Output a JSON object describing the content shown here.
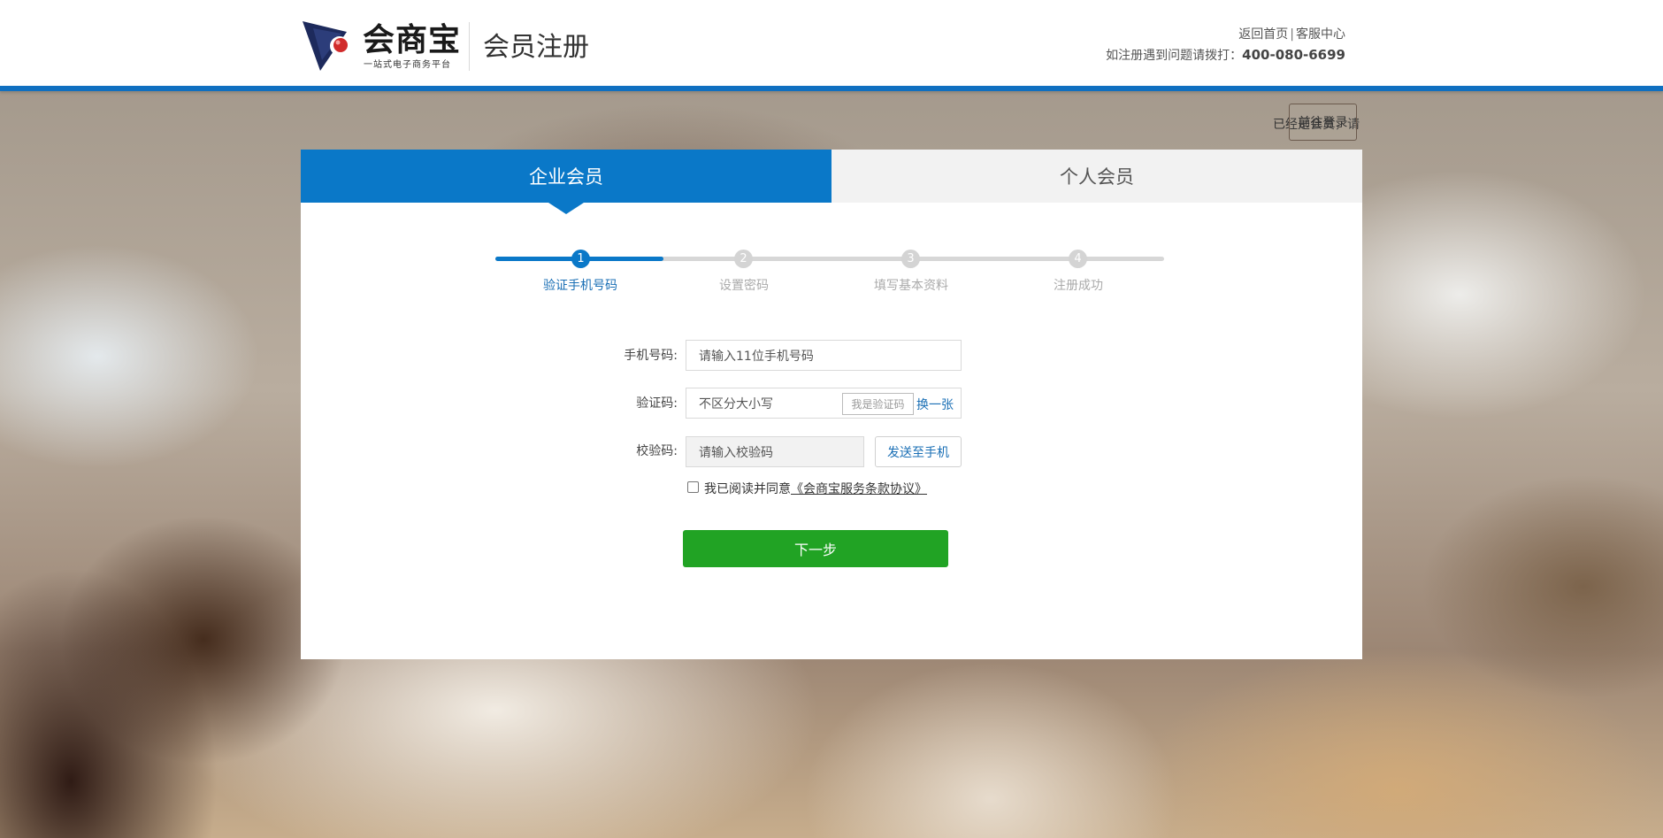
{
  "header": {
    "logo_name": "会商宝",
    "logo_tagline": "一站式电子商务平台",
    "page_title": "会员注册",
    "link_home": "返回首页",
    "link_separator": "|",
    "link_service": "客服中心",
    "hotline_prefix": "如注册遇到问题请拨打：",
    "hotline_number": "400-080-6699"
  },
  "login_prompt": {
    "text": "已经是会员，请",
    "button": "前往登录"
  },
  "tabs": [
    {
      "label": "企业会员",
      "active": true
    },
    {
      "label": "个人会员",
      "active": false
    }
  ],
  "steps": [
    {
      "number": "1",
      "label": "验证手机号码",
      "active": true
    },
    {
      "number": "2",
      "label": "设置密码",
      "active": false
    },
    {
      "number": "3",
      "label": "填写基本资料",
      "active": false
    },
    {
      "number": "4",
      "label": "注册成功",
      "active": false
    }
  ],
  "form": {
    "phone_label": "手机号码:",
    "phone_placeholder": "请输入11位手机号码",
    "captcha_label": "验证码:",
    "captcha_placeholder": "不区分大小写",
    "captcha_image_text": "我是验证码",
    "captcha_refresh": "换一张",
    "sms_label": "校验码:",
    "sms_placeholder": "请输入校验码",
    "sms_send": "发送至手机",
    "agree_text": "我已阅读并同意",
    "agree_link": "《会商宝服务条款协议》",
    "agree_checked": false,
    "next_button": "下一步"
  },
  "colors": {
    "primary_blue": "#0a78c8",
    "next_green": "#21a324",
    "link_blue": "#1a6fb5"
  }
}
